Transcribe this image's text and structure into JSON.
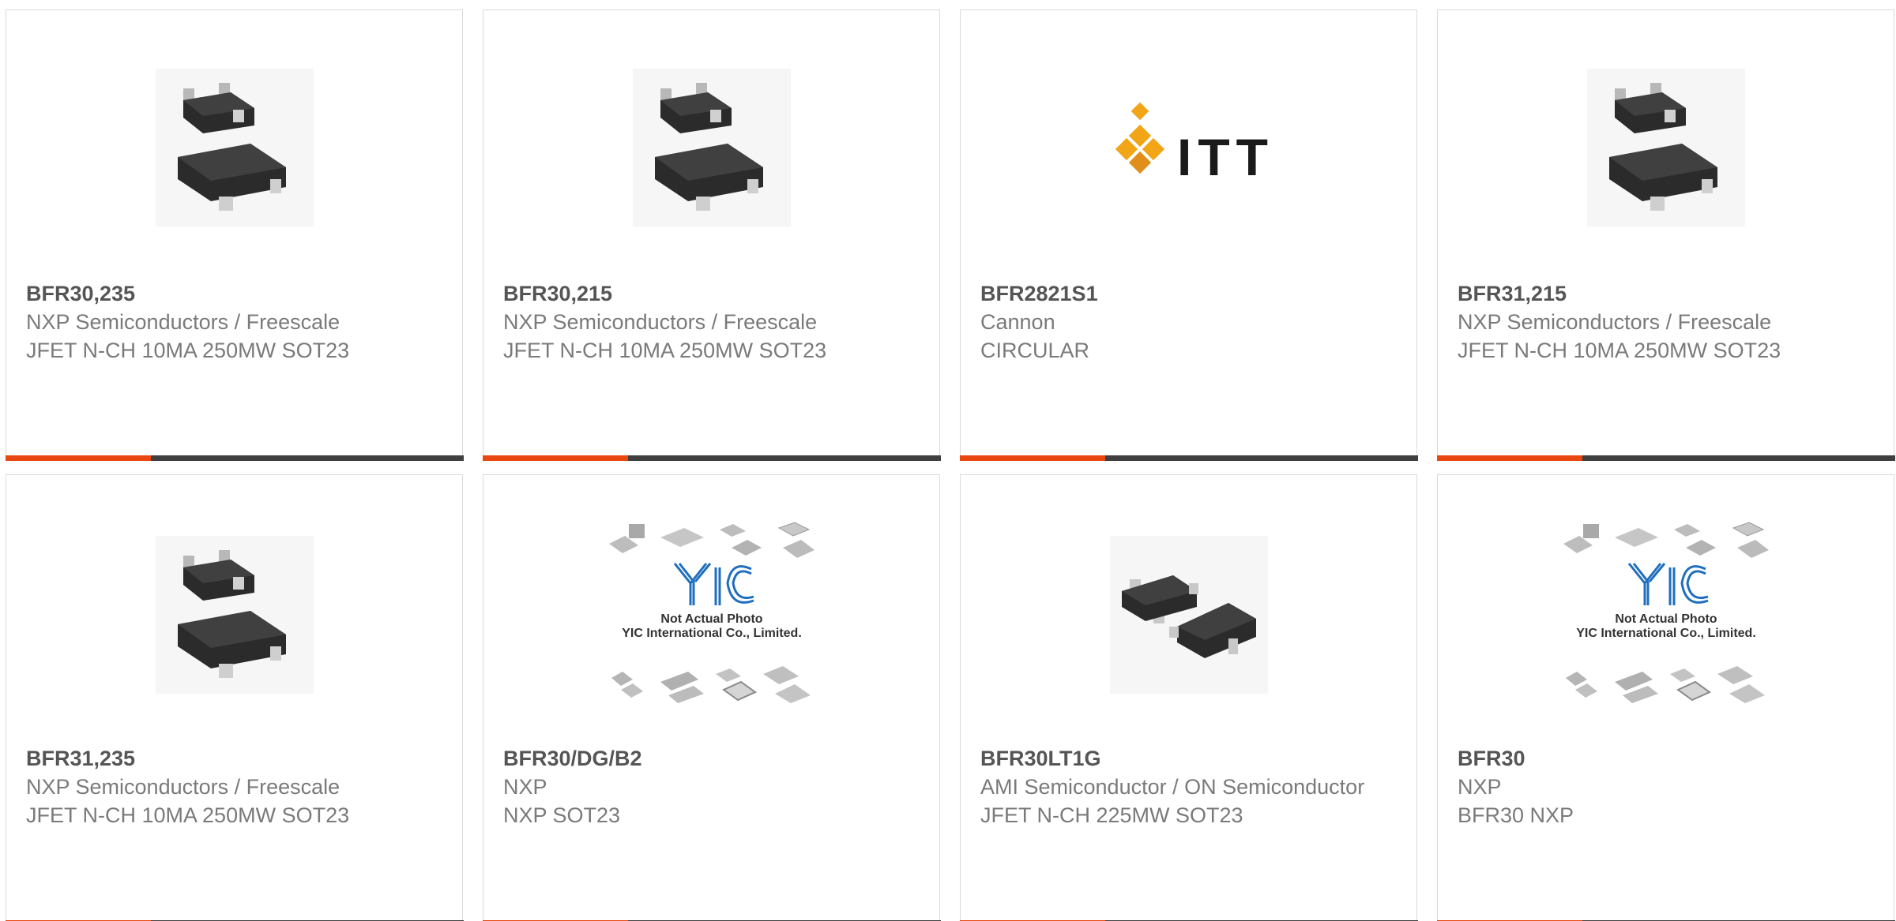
{
  "products": [
    {
      "part_number": "BFR30,235",
      "manufacturer": "NXP Semiconductors / Freescale",
      "description": "JFET N-CH 10MA 250MW SOT23",
      "image": "sot23-transistor-icon"
    },
    {
      "part_number": "BFR30,215",
      "manufacturer": "NXP Semiconductors / Freescale",
      "description": "JFET N-CH 10MA 250MW SOT23",
      "image": "sot23-transistor-icon"
    },
    {
      "part_number": "BFR2821S1",
      "manufacturer": "Cannon",
      "description": "CIRCULAR",
      "image": "itt-logo"
    },
    {
      "part_number": "BFR31,215",
      "manufacturer": "NXP Semiconductors / Freescale",
      "description": "JFET N-CH 10MA 250MW SOT23",
      "image": "sot23-transistor-icon"
    },
    {
      "part_number": "BFR31,235",
      "manufacturer": "NXP Semiconductors / Freescale",
      "description": "JFET N-CH 10MA 250MW SOT23",
      "image": "sot23-transistor-icon"
    },
    {
      "part_number": "BFR30/DG/B2",
      "manufacturer": "NXP",
      "description": "NXP SOT23",
      "image": "yic-placeholder-image",
      "image_text": [
        "Not Actual Photo",
        "YIC International Co., Limited."
      ]
    },
    {
      "part_number": "BFR30LT1G",
      "manufacturer": "AMI Semiconductor / ON Semiconductor",
      "description": "JFET N-CH 225MW SOT23",
      "image": "sot23-transistor-side-icon"
    },
    {
      "part_number": "BFR30",
      "manufacturer": "NXP",
      "description": "BFR30 NXP",
      "image": "yic-placeholder-image",
      "image_text": [
        "Not Actual Photo",
        "YIC International Co., Limited."
      ]
    }
  ],
  "logo_text": "ITT",
  "colors": {
    "accent": "#e8470f",
    "bar": "#3f3f3f",
    "border": "#dadada",
    "title": "#555555",
    "text": "#7a7a7a"
  }
}
